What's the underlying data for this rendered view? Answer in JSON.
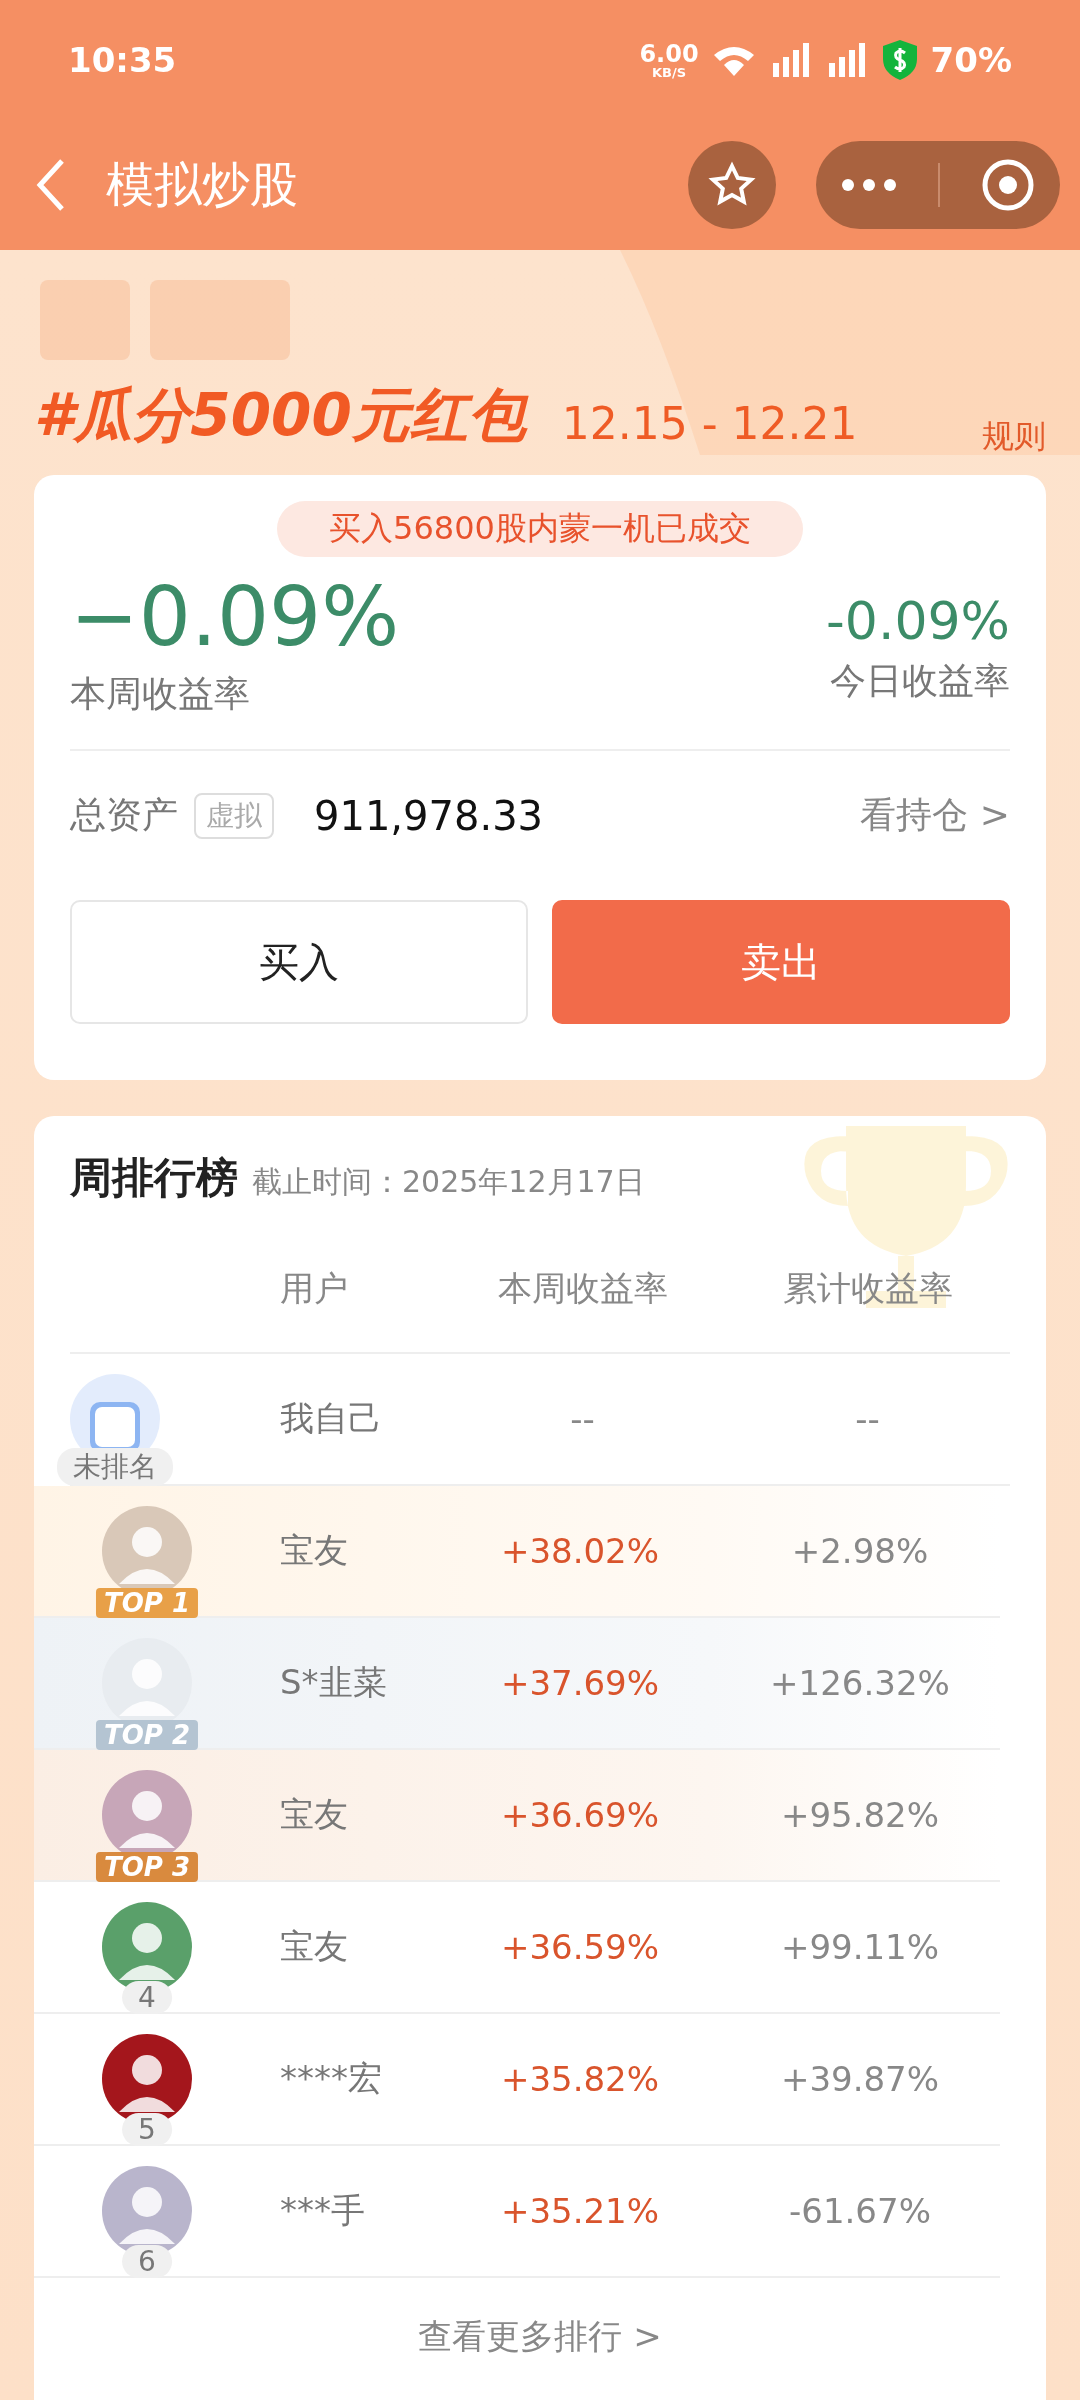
{
  "status_bar": {
    "time": "10:35",
    "net_speed": "6.00",
    "net_unit": "KB/S",
    "battery": "70%"
  },
  "header": {
    "title": "模拟炒股"
  },
  "banner": {
    "title": "#瓜分5000元红包",
    "dates": "12.15 - 12.21",
    "rules_link": "规则"
  },
  "account": {
    "notice": "买入56800股内蒙一机已成交",
    "week_return": "−0.09%",
    "week_label": "本周收益率",
    "today_return": "-0.09%",
    "today_label": "今日收益率",
    "assets_label": "总资产",
    "virtual_tag": "虚拟",
    "assets_value": "911,978.33",
    "holdings_link": "看持仓 >",
    "buy_button": "买入",
    "sell_button": "卖出"
  },
  "ranking": {
    "title": "周排行榜",
    "cutoff": "截止时间：2025年12月17日",
    "columns": [
      "用户",
      "本周收益率",
      "累计收益率"
    ],
    "my_row": {
      "badge": "未排名",
      "name": "我自己",
      "week": "--",
      "total": "--"
    },
    "rows": [
      {
        "kind": "top",
        "badge": "TOP 1",
        "color": "#e8a048",
        "name": "宝友",
        "week": "+38.02%",
        "total": "+2.98%"
      },
      {
        "kind": "top",
        "badge": "TOP 2",
        "color": "#b4c4d2",
        "name": "S*韭菜",
        "week": "+37.69%",
        "total": "+126.32%"
      },
      {
        "kind": "top",
        "badge": "TOP 3",
        "color": "#d98a3e",
        "name": "宝友",
        "week": "+36.69%",
        "total": "+95.82%"
      },
      {
        "kind": "normal",
        "badge": "4",
        "name": "宝友",
        "week": "+36.59%",
        "total": "+99.11%"
      },
      {
        "kind": "normal",
        "badge": "5",
        "name": "****宏",
        "week": "+35.82%",
        "total": "+39.87%"
      },
      {
        "kind": "normal",
        "badge": "6",
        "name": "***手",
        "week": "+35.21%",
        "total": "-61.67%"
      }
    ],
    "more_link": "查看更多排行 >"
  }
}
